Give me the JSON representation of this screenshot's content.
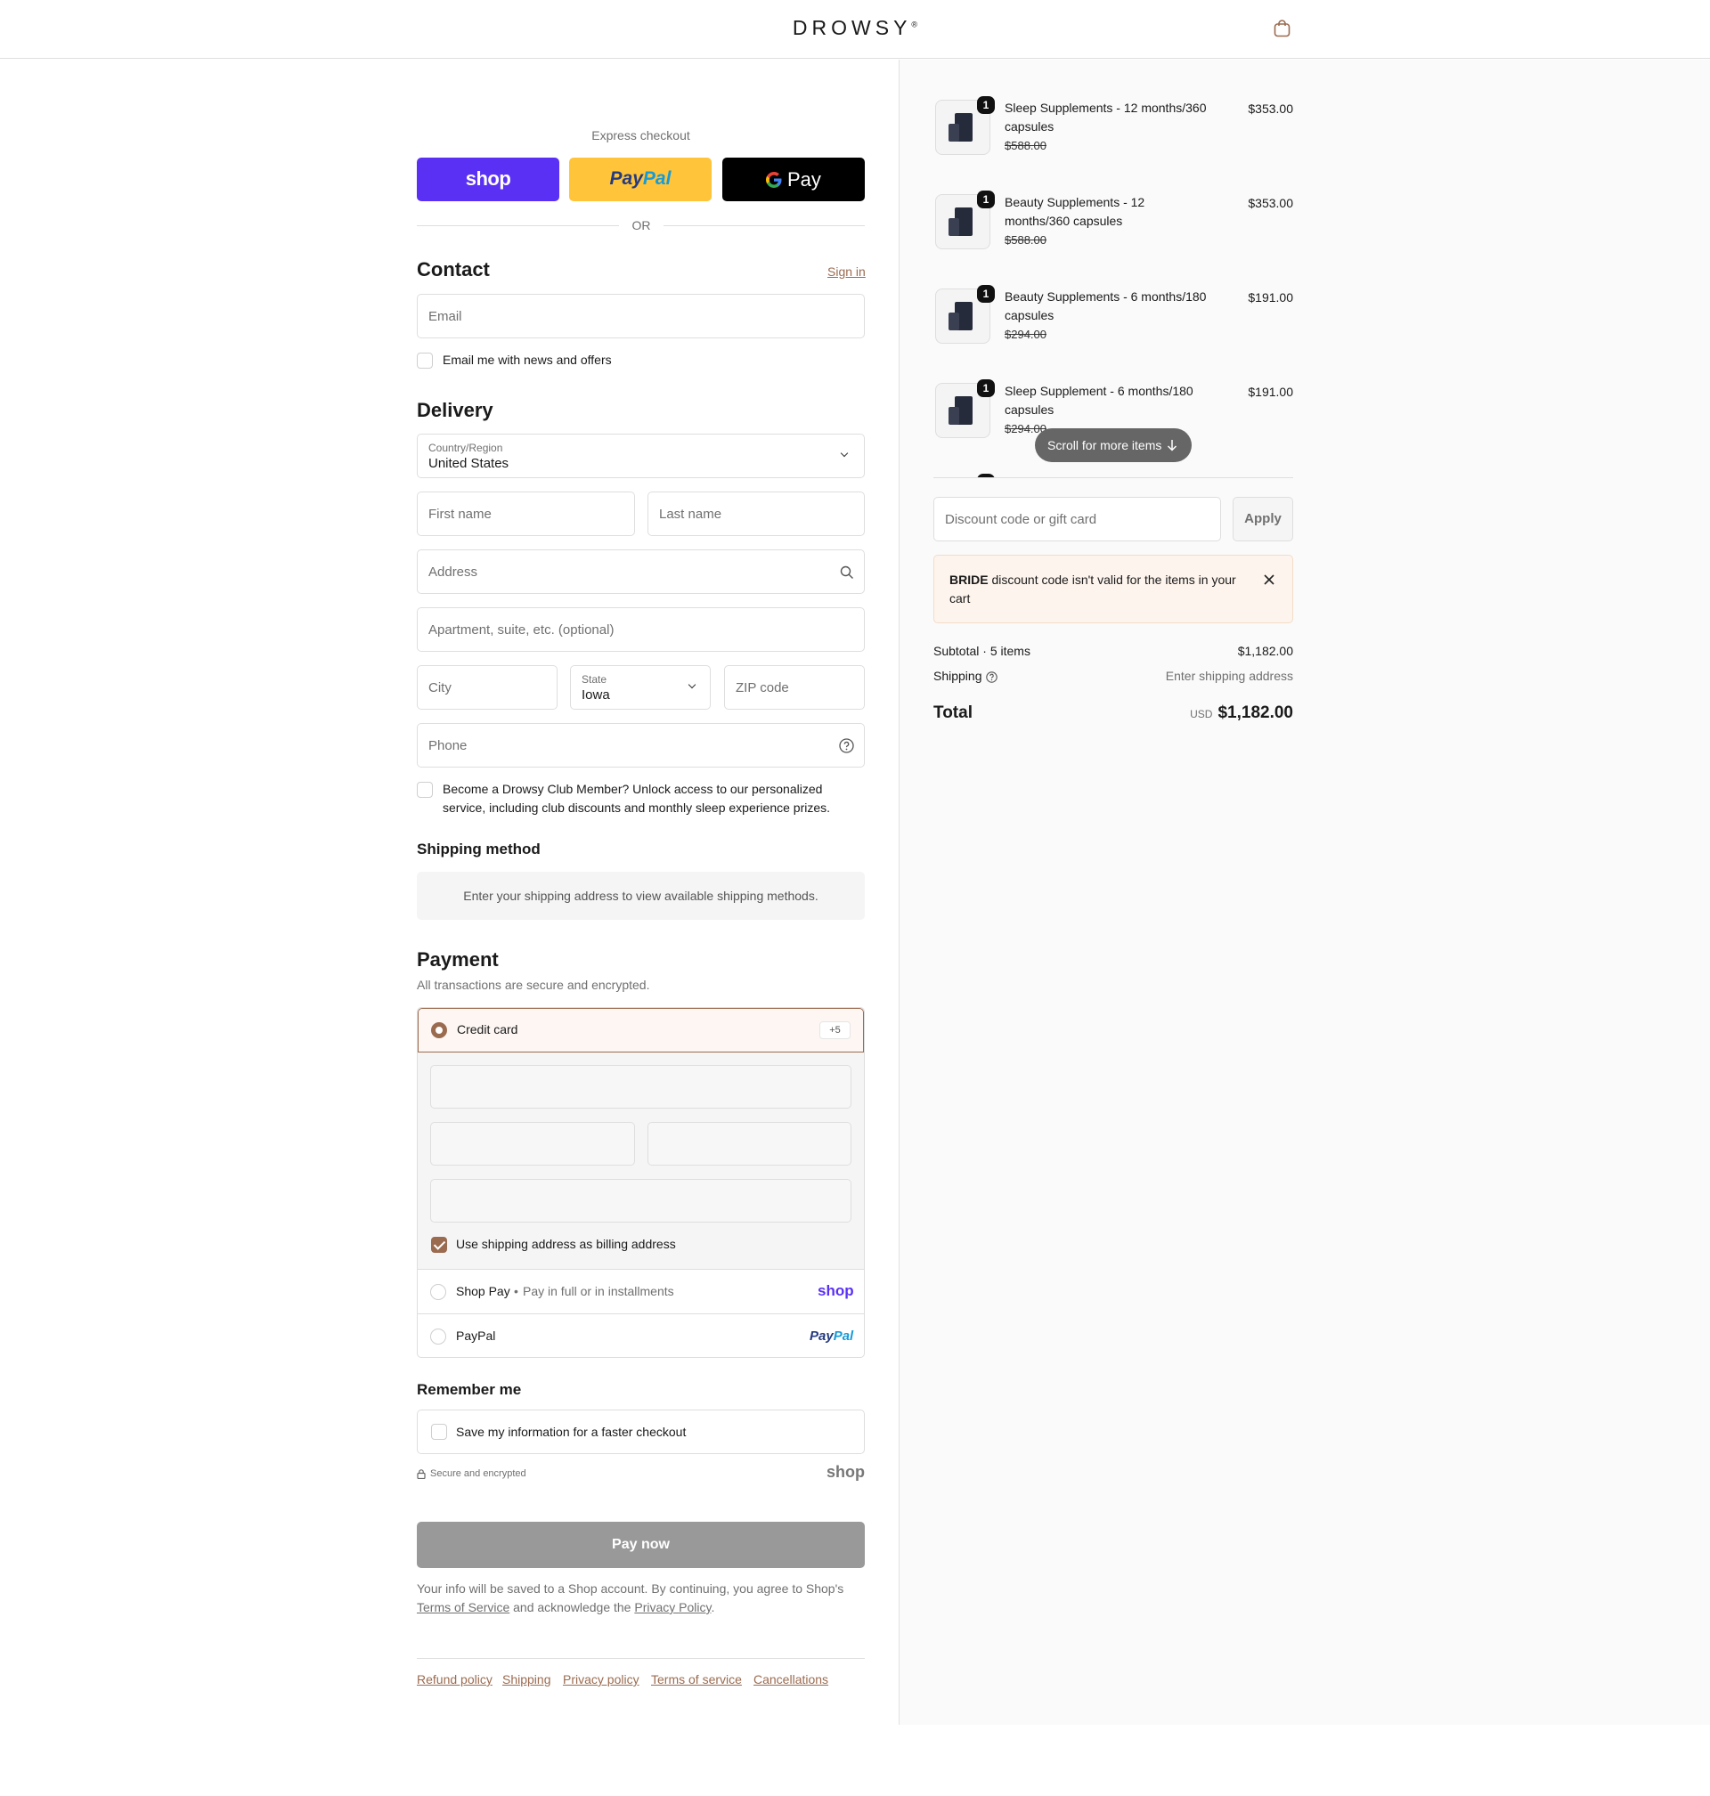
{
  "header": {
    "brand": "DROWSY",
    "brand_mark": "®"
  },
  "express": {
    "title": "Express checkout",
    "shop_label": "shop",
    "paypal_label_a": "Pay",
    "paypal_label_b": "Pal",
    "gpay_label": "Pay",
    "or": "OR"
  },
  "contact": {
    "title": "Contact",
    "sign_in": "Sign in",
    "email_placeholder": "Email",
    "news_label": "Email me with news and offers"
  },
  "delivery": {
    "title": "Delivery",
    "country_label": "Country/Region",
    "country_value": "United States",
    "first_name": "First name",
    "last_name": "Last name",
    "address": "Address",
    "apartment": "Apartment, suite, etc. (optional)",
    "city": "City",
    "state_label": "State",
    "state_value": "Iowa",
    "zip": "ZIP code",
    "phone": "Phone",
    "club_label": "Become a Drowsy Club Member? Unlock access to our personalized service, including club discounts and monthly sleep experience prizes."
  },
  "shipping_method": {
    "title": "Shipping method",
    "message": "Enter your shipping address to view available shipping methods."
  },
  "payment": {
    "title": "Payment",
    "subtitle": "All transactions are secure and encrypted.",
    "credit_card": "Credit card",
    "more_badge": "+5",
    "billing_label": "Use shipping address as billing address",
    "shop_pay": "Shop Pay",
    "shop_pay_sub": "Pay in full or in installments",
    "shop_logo": "shop",
    "paypal": "PayPal",
    "paypal_logo_a": "Pay",
    "paypal_logo_b": "Pal"
  },
  "remember": {
    "title": "Remember me",
    "save_label": "Save my information for a faster checkout",
    "secure": "Secure and encrypted",
    "shop_logo": "shop"
  },
  "pay_now": "Pay now",
  "legal": {
    "text_1": "Your info will be saved to a Shop account. By continuing, you agree to Shop's",
    "terms": "Terms of Service",
    "text_2": "and acknowledge the",
    "privacy": "Privacy Policy",
    "text_3": "."
  },
  "footer": {
    "links": [
      "Refund policy",
      "Shipping",
      "Privacy policy",
      "Terms of service",
      "Cancellations"
    ]
  },
  "cart": {
    "items": [
      {
        "qty": "1",
        "name": "Sleep Supplements - 12 months/360 capsules",
        "original": "$588.00",
        "price": "$353.00"
      },
      {
        "qty": "1",
        "name": "Beauty Supplements - 12 months/360 capsules",
        "original": "$588.00",
        "price": "$353.00"
      },
      {
        "qty": "1",
        "name": "Beauty Supplements - 6 months/180 capsules",
        "original": "$294.00",
        "price": "$191.00"
      },
      {
        "qty": "1",
        "name": "Sleep Supplement - 6 months/180 capsules",
        "original": "$294.00",
        "price": "$191.00"
      }
    ],
    "scroll_hint": "Scroll for more items",
    "discount_placeholder": "Discount code or gift card",
    "apply": "Apply",
    "error_code": "BRIDE",
    "error_text": "discount code isn't valid for the items in your cart",
    "subtotal_label": "Subtotal · 5 items",
    "subtotal_value": "$1,182.00",
    "shipping_label": "Shipping",
    "shipping_value": "Enter shipping address",
    "total_label": "Total",
    "currency": "USD",
    "total_value": "$1,182.00"
  }
}
